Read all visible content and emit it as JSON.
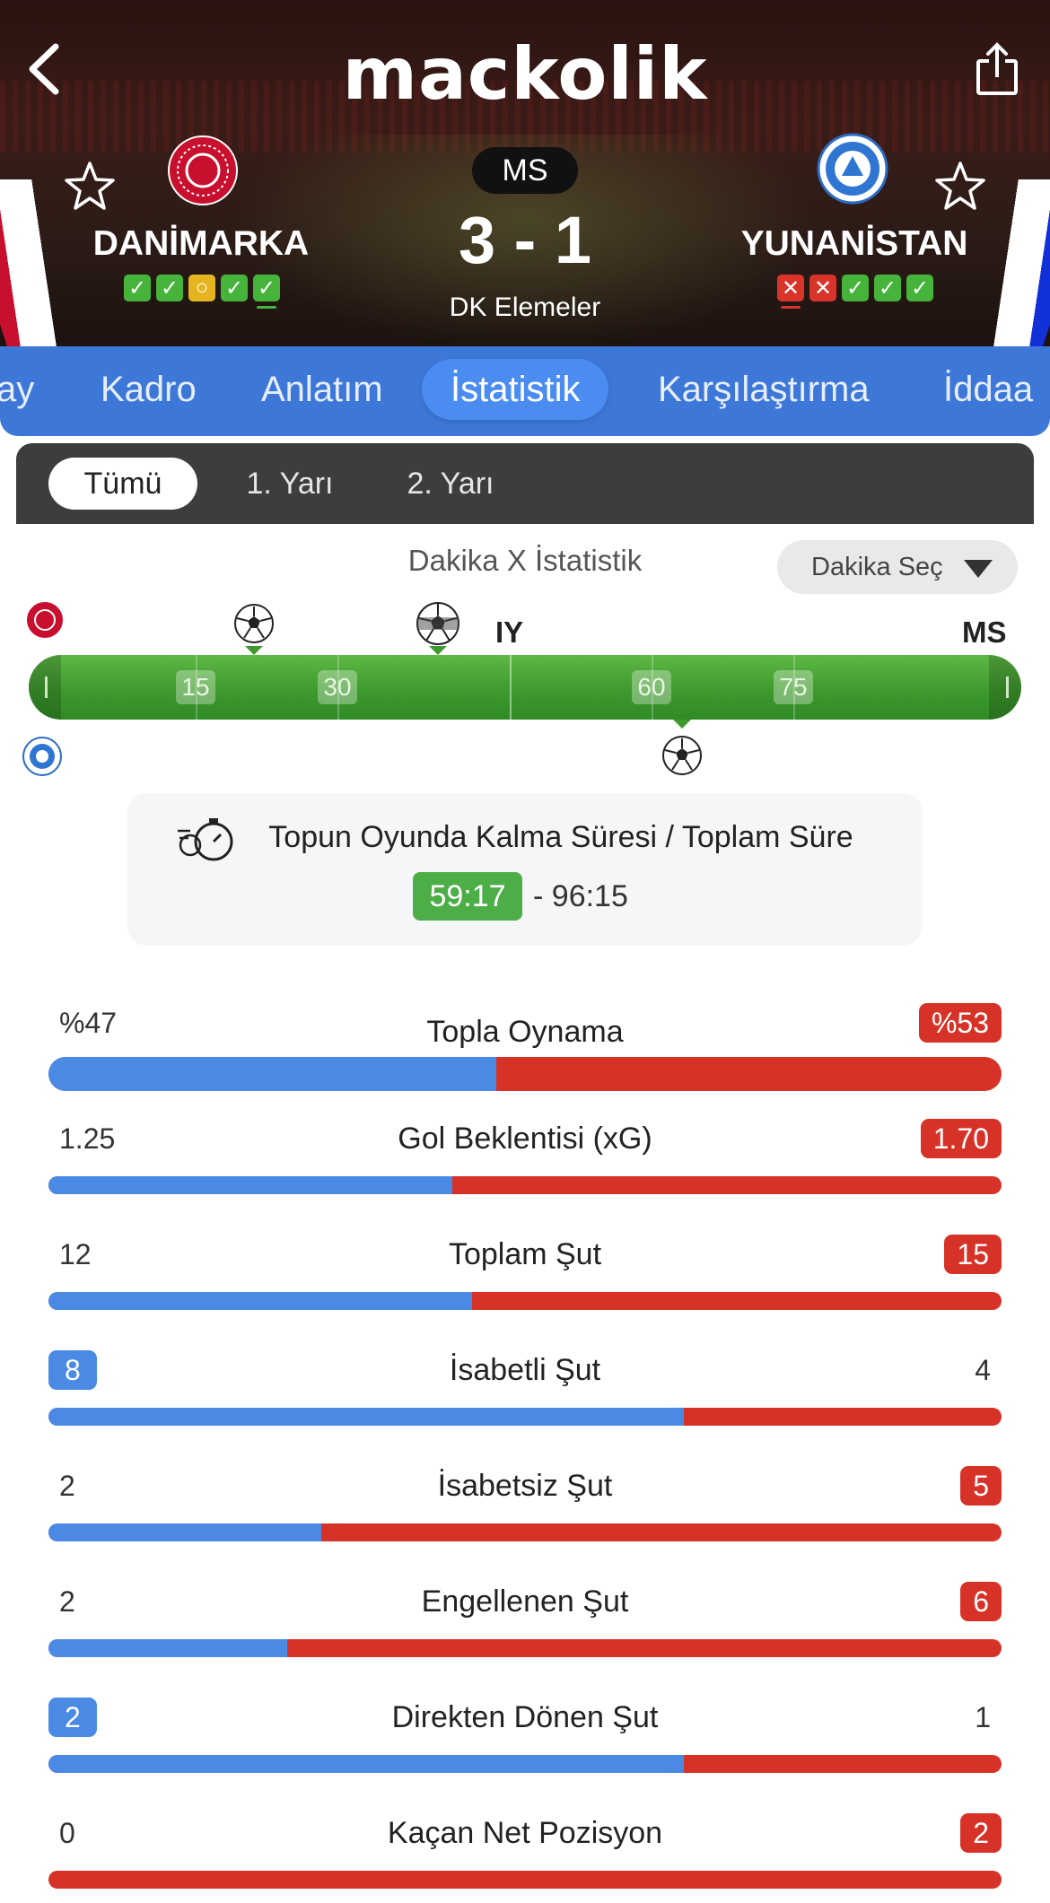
{
  "header": {
    "logo": "mackolik",
    "status": "MS",
    "score": "3 - 1",
    "competition": "DK Elemeler",
    "home": {
      "name": "DANİMARKA",
      "form": [
        "w",
        "w",
        "d",
        "w",
        "w"
      ]
    },
    "away": {
      "name": "YUNANİSTAN",
      "form": [
        "l",
        "l",
        "w",
        "w",
        "w"
      ]
    },
    "colors": {
      "win": "#46b43a",
      "draw": "#e5b520",
      "loss": "#d8342a"
    }
  },
  "tabs": [
    {
      "label": "ay"
    },
    {
      "label": "Kadro"
    },
    {
      "label": "Anlatım"
    },
    {
      "label": "İstatistik",
      "active": true
    },
    {
      "label": "Karşılaştırma"
    },
    {
      "label": "İddaa"
    }
  ],
  "periods": [
    {
      "label": "Tümü",
      "active": true
    },
    {
      "label": "1. Yarı"
    },
    {
      "label": "2. Yarı"
    }
  ],
  "timeline": {
    "title": "Dakika X İstatistik",
    "minute_select": "Dakika Seç",
    "ticks": [
      "15",
      "30",
      "60",
      "75"
    ],
    "half_label": "IY",
    "full_label": "MS"
  },
  "ball_in_play": {
    "title": "Topun Oyunda Kalma Süresi / Toplam Süre",
    "in_play": "59:17",
    "separator": "-",
    "total": "96:15"
  },
  "stats": [
    {
      "label": "Topla Oynama",
      "home": "%47",
      "away": "%53",
      "home_share": 0.47,
      "badge": "away"
    },
    {
      "label": "Gol Beklentisi (xG)",
      "home": "1.25",
      "away": "1.70",
      "home_share": 0.424,
      "badge": "away"
    },
    {
      "label": "Toplam Şut",
      "home": "12",
      "away": "15",
      "home_share": 0.444,
      "badge": "away"
    },
    {
      "label": "İsabetli Şut",
      "home": "8",
      "away": "4",
      "home_share": 0.667,
      "badge": "home"
    },
    {
      "label": "İsabetsiz Şut",
      "home": "2",
      "away": "5",
      "home_share": 0.286,
      "badge": "away"
    },
    {
      "label": "Engellenen Şut",
      "home": "2",
      "away": "6",
      "home_share": 0.25,
      "badge": "away"
    },
    {
      "label": "Direkten Dönen Şut",
      "home": "2",
      "away": "1",
      "home_share": 0.667,
      "badge": "home"
    },
    {
      "label": "Kaçan Net Pozisyon",
      "home": "0",
      "away": "2",
      "home_share": 0.0,
      "badge": "away"
    }
  ],
  "accent_colors": {
    "home": "#4a8ae5",
    "away": "#d73228"
  }
}
